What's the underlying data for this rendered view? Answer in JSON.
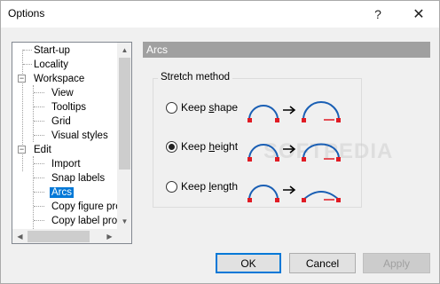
{
  "window": {
    "title": "Options",
    "help": "?",
    "close": "✕"
  },
  "tree": {
    "items": [
      {
        "label": "Start-up"
      },
      {
        "label": "Locality"
      },
      {
        "label": "Workspace",
        "expander": "−"
      },
      {
        "label": "View"
      },
      {
        "label": "Tooltips"
      },
      {
        "label": "Grid"
      },
      {
        "label": "Visual styles"
      },
      {
        "label": "Edit",
        "expander": "−"
      },
      {
        "label": "Import"
      },
      {
        "label": "Snap labels"
      },
      {
        "label": "Arcs",
        "selected": true
      },
      {
        "label": "Copy figure prop"
      },
      {
        "label": "Copy label prop"
      }
    ]
  },
  "section": {
    "title": "Arcs"
  },
  "stretch": {
    "label": "Stretch method",
    "options": [
      {
        "pre": "Keep ",
        "u": "s",
        "post": "hape",
        "checked": false
      },
      {
        "pre": "Keep ",
        "u": "h",
        "post": "eight",
        "checked": true
      },
      {
        "pre": "Keep ",
        "u": "l",
        "post": "ength",
        "checked": false
      }
    ]
  },
  "watermark": "SOFTPEDIA",
  "buttons": {
    "ok": "OK",
    "cancel": "Cancel",
    "apply": "Apply"
  },
  "colors": {
    "arc": "#1a5fb4",
    "handle": "#e01b24",
    "selection": "#0078d7",
    "section_header": "#a0a0a0"
  }
}
